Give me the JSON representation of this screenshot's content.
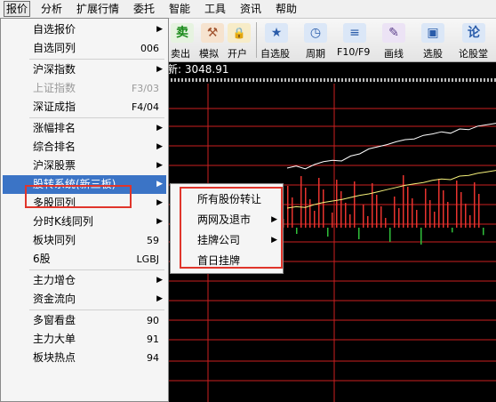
{
  "menubar": {
    "items": [
      "报价",
      "分析",
      "扩展行情",
      "委托",
      "智能",
      "工具",
      "资讯",
      "帮助"
    ]
  },
  "toolbar": {
    "buttons": [
      {
        "label": "卖出",
        "icon": "sell-icon",
        "glyph": "卖"
      },
      {
        "label": "模拟",
        "icon": "gavel-icon",
        "glyph": "⚒"
      },
      {
        "label": "开户",
        "icon": "lock-icon",
        "glyph": "🔒"
      },
      {
        "label": "自选股",
        "icon": "star-icon",
        "glyph": "★"
      },
      {
        "label": "周期",
        "icon": "clock-icon",
        "glyph": "◷"
      },
      {
        "label": "F10/F9",
        "icon": "f10-icon",
        "glyph": "≡"
      },
      {
        "label": "画线",
        "icon": "pencil-icon",
        "glyph": "✎"
      },
      {
        "label": "选股",
        "icon": "screen-icon",
        "glyph": "▣"
      },
      {
        "label": "论股堂",
        "icon": "forum-icon",
        "glyph": "论"
      }
    ]
  },
  "status": {
    "text": "新: 3048.91"
  },
  "menu": {
    "items": [
      {
        "label": "自选报价",
        "shortcut": "",
        "arrow": true
      },
      {
        "label": "自选同列",
        "shortcut": "006",
        "arrow": false
      },
      {
        "sep": true
      },
      {
        "label": "沪深指数",
        "shortcut": "",
        "arrow": true
      },
      {
        "label": "上证指数",
        "shortcut": "F3/03",
        "arrow": false,
        "disabled": true
      },
      {
        "label": "深证成指",
        "shortcut": "F4/04",
        "arrow": false
      },
      {
        "sep": true
      },
      {
        "label": "涨幅排名",
        "shortcut": "",
        "arrow": true
      },
      {
        "label": "综合排名",
        "shortcut": "",
        "arrow": true
      },
      {
        "label": "沪深股票",
        "shortcut": "",
        "arrow": true
      },
      {
        "label": "股转系统(新三板)",
        "shortcut": "",
        "arrow": true,
        "highlighted": true
      },
      {
        "label": "多股同列",
        "shortcut": "",
        "arrow": true
      },
      {
        "label": "分时K线同列",
        "shortcut": "",
        "arrow": true
      },
      {
        "label": "板块同列",
        "shortcut": "59",
        "arrow": false
      },
      {
        "label": "6股",
        "shortcut": "LGBJ",
        "arrow": false
      },
      {
        "sep": true
      },
      {
        "label": "主力增仓",
        "shortcut": "",
        "arrow": true
      },
      {
        "label": "资金流向",
        "shortcut": "",
        "arrow": true
      },
      {
        "sep": true
      },
      {
        "label": "多窗看盘",
        "shortcut": "90",
        "arrow": false
      },
      {
        "label": "主力大单",
        "shortcut": "91",
        "arrow": false
      },
      {
        "label": "板块热点",
        "shortcut": "94",
        "arrow": false
      }
    ]
  },
  "submenu": {
    "items": [
      {
        "label": "所有股份转让",
        "arrow": false
      },
      {
        "label": "两网及退市",
        "arrow": true
      },
      {
        "label": "挂牌公司",
        "arrow": true
      },
      {
        "label": "首日挂牌",
        "arrow": false
      }
    ]
  },
  "chart_data": {
    "type": "line",
    "series": [
      {
        "values": [
          0.25,
          0.28,
          0.24,
          0.3,
          0.34,
          0.36,
          0.35,
          0.42,
          0.45,
          0.52,
          0.55,
          0.58,
          0.62,
          0.65,
          0.66,
          0.71,
          0.73,
          0.76,
          0.74,
          0.8,
          0.79,
          0.84,
          0.86,
          0.88
        ]
      },
      {
        "values": [
          0.1,
          0.12,
          0.11,
          0.15,
          0.18,
          0.2,
          0.22,
          0.25,
          0.28,
          0.3,
          0.33,
          0.36,
          0.39,
          0.42,
          0.44,
          0.46,
          0.49,
          0.51,
          0.5,
          0.55,
          0.56,
          0.59,
          0.61,
          0.63
        ]
      }
    ]
  },
  "colors": {
    "menu_highlight": "#3b74c6",
    "annotation_box": "#e0352b",
    "grid_red": "#cc1f1f",
    "line_white": "#ffffff",
    "line_yellow": "#f5f07a",
    "bar_up": "#e8332e",
    "bar_down": "#2fbf3a"
  }
}
